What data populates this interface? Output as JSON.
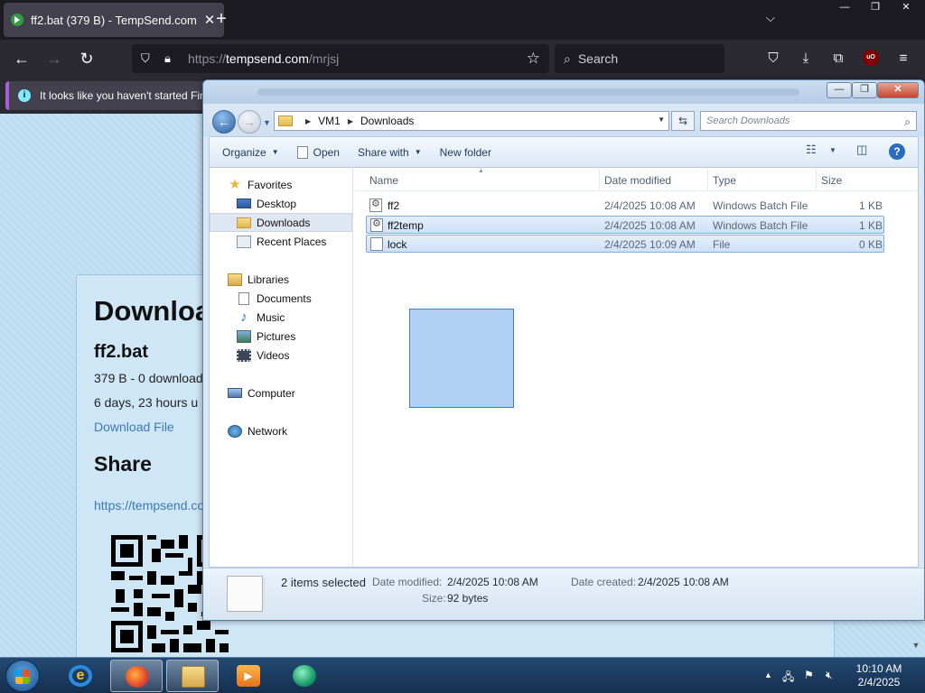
{
  "browser": {
    "tab_title": "ff2.bat (379 B) - TempSend.com",
    "tab_close": "✕",
    "new_tab": "+",
    "list_tabs": "⌵",
    "win_minimize": "—",
    "win_restore": "❐",
    "win_close": "✕",
    "back": "←",
    "forward": "→",
    "reload": "↻",
    "url_scheme": "https://",
    "url_host": "tempsend.com",
    "url_path": "/mrjsj",
    "bookmark_star": "☆",
    "search_placeholder": "Search",
    "pocket": "⛉",
    "downloads": "⤓",
    "extensions": "⧉",
    "ublock": "uO",
    "menu": "≡",
    "notice": "It looks like you haven't started Fir"
  },
  "webpage": {
    "heading": "Downloa",
    "filename": "ff2.bat",
    "size_line": "379 B - 0 download",
    "expiry_line": "6 days, 23 hours u",
    "download_link": "Download File",
    "share_heading": "Share",
    "share_link": "https://tempsend.co"
  },
  "explorer": {
    "breadcrumb": [
      "VM1",
      "Downloads"
    ],
    "search_placeholder": "Search Downloads",
    "toolbar": {
      "organize": "Organize",
      "open": "Open",
      "share_with": "Share with",
      "new_folder": "New folder"
    },
    "nav": {
      "favorites": "Favorites",
      "desktop": "Desktop",
      "downloads": "Downloads",
      "recent": "Recent Places",
      "libraries": "Libraries",
      "documents": "Documents",
      "music": "Music",
      "pictures": "Pictures",
      "videos": "Videos",
      "computer": "Computer",
      "network": "Network"
    },
    "columns": {
      "name": "Name",
      "date": "Date modified",
      "type": "Type",
      "size": "Size"
    },
    "files": [
      {
        "name": "ff2",
        "date": "2/4/2025 10:08 AM",
        "type": "Windows Batch File",
        "size": "1 KB"
      },
      {
        "name": "ff2temp",
        "date": "2/4/2025 10:08 AM",
        "type": "Windows Batch File",
        "size": "1 KB"
      },
      {
        "name": "lock",
        "date": "2/4/2025 10:09 AM",
        "type": "File",
        "size": "0 KB"
      }
    ],
    "details": {
      "selected": "2 items selected",
      "date_modified_label": "Date modified:",
      "date_modified": "2/4/2025 10:08 AM",
      "date_created_label": "Date created:",
      "date_created": "2/4/2025 10:08 AM",
      "size_label": "Size:",
      "size": "92 bytes"
    }
  },
  "taskbar": {
    "clock_time": "10:10 AM",
    "clock_date": "2/4/2025"
  }
}
